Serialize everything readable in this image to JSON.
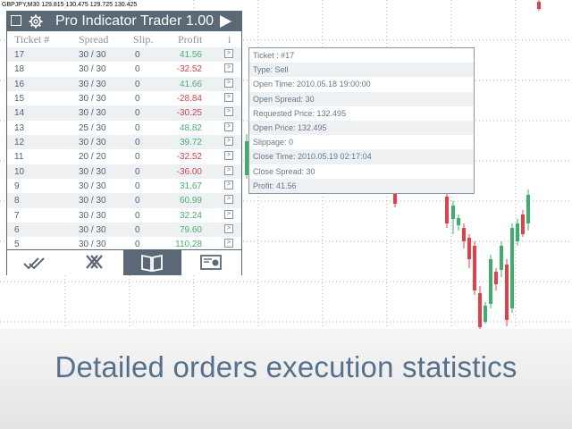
{
  "symbol_info": "GBPJPY,M30  129.815 130.475 129.725 130.425",
  "panel": {
    "title": "Pro Indicator Trader 1.00",
    "headers": {
      "ticket": "Ticket #",
      "spread": "Spread",
      "slip": "Slip.",
      "profit": "Profit",
      "info": "i"
    },
    "rows": [
      {
        "ticket": "17",
        "spread": "30 / 30",
        "slip": "0",
        "profit": "41.56",
        "btn": ">"
      },
      {
        "ticket": "18",
        "spread": "30 / 30",
        "slip": "0",
        "profit": "-32.52",
        "btn": ">"
      },
      {
        "ticket": "16",
        "spread": "30 / 30",
        "slip": "0",
        "profit": "41.66",
        "btn": ">"
      },
      {
        "ticket": "15",
        "spread": "30 / 30",
        "slip": "0",
        "profit": "-28.84",
        "btn": ">"
      },
      {
        "ticket": "14",
        "spread": "30 / 30",
        "slip": "0",
        "profit": "-30.25",
        "btn": ">"
      },
      {
        "ticket": "13",
        "spread": "25 / 30",
        "slip": "0",
        "profit": "48.82",
        "btn": ">"
      },
      {
        "ticket": "12",
        "spread": "30 / 30",
        "slip": "0",
        "profit": "39.72",
        "btn": ">"
      },
      {
        "ticket": "11",
        "spread": "20 / 20",
        "slip": "0",
        "profit": "-32.52",
        "btn": ">"
      },
      {
        "ticket": "10",
        "spread": "30 / 30",
        "slip": "0",
        "profit": "-36.00",
        "btn": ">"
      },
      {
        "ticket": "9",
        "spread": "30 / 30",
        "slip": "0",
        "profit": "31.67",
        "btn": ">"
      },
      {
        "ticket": "8",
        "spread": "30 / 30",
        "slip": "0",
        "profit": "60.99",
        "btn": ">"
      },
      {
        "ticket": "7",
        "spread": "30 / 30",
        "slip": "0",
        "profit": "32.24",
        "btn": ">"
      },
      {
        "ticket": "6",
        "spread": "30 / 30",
        "slip": "0",
        "profit": "79.60",
        "btn": ">"
      },
      {
        "ticket": "5",
        "spread": "30 / 30",
        "slip": "0",
        "profit": "110.28",
        "btn": ">"
      }
    ],
    "toolbar": [
      {
        "name": "check-double-icon",
        "active": false
      },
      {
        "name": "close-double-icon",
        "active": false
      },
      {
        "name": "book-icon",
        "active": true
      },
      {
        "name": "report-icon",
        "active": false
      }
    ]
  },
  "tooltip": {
    "lines": [
      "Ticket : #17",
      "Type: Sell",
      "Open Time: 2010.05.18 19:00:00",
      "Open Spread: 30",
      "Requested Price: 132.495",
      "Open Price: 132.495",
      "Slippage: 0",
      "Close Time: 2010.05.19 02:17:04",
      "Close Spread: 30",
      "Profit: 41.56"
    ]
  },
  "tagline": "Detailed orders execution statistics",
  "colors": {
    "panel_bar": "#5b6875",
    "profit_positive": "#4ab06a",
    "profit_negative": "#d8434b",
    "tagline": "#55708c",
    "bull_candle": "#3fae6a",
    "bear_candle": "#e0404a"
  }
}
